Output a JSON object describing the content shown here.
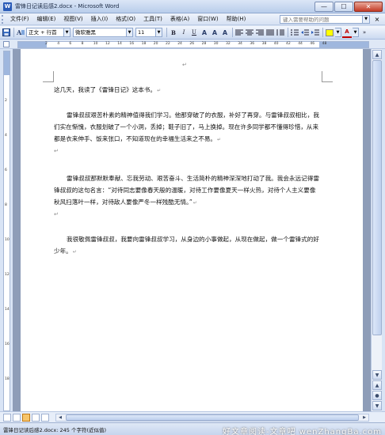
{
  "window": {
    "title": "雷锋日记读后感2.docx - Microsoft Word",
    "app_icon": "W",
    "minimize_glyph": "—",
    "maximize_glyph": "☐",
    "close_glyph": "✕"
  },
  "menu": {
    "items": [
      "文件(F)",
      "编辑(E)",
      "视图(V)",
      "插入(I)",
      "格式(O)",
      "工具(T)",
      "表格(A)",
      "窗口(W)",
      "帮助(H)"
    ],
    "help_placeholder": "键入需要帮助的问题",
    "close_glyph": "×"
  },
  "toolbar": {
    "style_value": "正文 + 行首",
    "font_value": "微软雅黑",
    "size_value": "11",
    "bold": "B",
    "italic": "I",
    "underline": "U",
    "font_a": "A",
    "char_a": "A",
    "char_a2": "A",
    "highlight_color": "#ffff00",
    "font_color": "#c00000"
  },
  "ruler": {
    "numbers": [
      "2",
      "4",
      "6",
      "8",
      "10",
      "12",
      "14",
      "16",
      "18",
      "20",
      "22",
      "24",
      "26",
      "28",
      "30",
      "32",
      "34",
      "36",
      "38",
      "40",
      "42",
      "44",
      "46",
      "48"
    ]
  },
  "document": {
    "return_mark": "↵",
    "paragraphs": [
      "这几天，我读了《雷锋日记》这本书。",
      "雷锋叔叔艰苦朴素的精神值得我们学习。他那穿破了的衣服，补好了再穿。与雷锋叔叔相比，我们实在惭愧，衣服划破了一个小洞，丢掉；鞋子旧了，马上换掉。现在许多同学都不懂得珍惜，从来都是衣来伸手、饭来张口，不知道现在的幸福生活来之不易。",
      "雷锋叔叔那默默奉献、忘我劳动、艰苦奋斗、生活简朴的精神深深地打动了我。我会永远记得雷锋叔叔的这句名言：“对待同志要像春天般的温暖，对待工作要像夏天一样火热，对待个人主义要像秋风扫落叶一样，对待敌人要像严冬一样残酷无情。”",
      "我很敬佩雷锋叔叔，我要向雷锋叔叔学习，从身边的小事做起，从现在做起，做一个雷锋式的好少年。"
    ]
  },
  "statusbar": {
    "text": "雷锋日记读后感2.docx: 245 个字符(近似值)",
    "watermark": "好文章阅读-文章吧  wenZhangBa.com"
  }
}
